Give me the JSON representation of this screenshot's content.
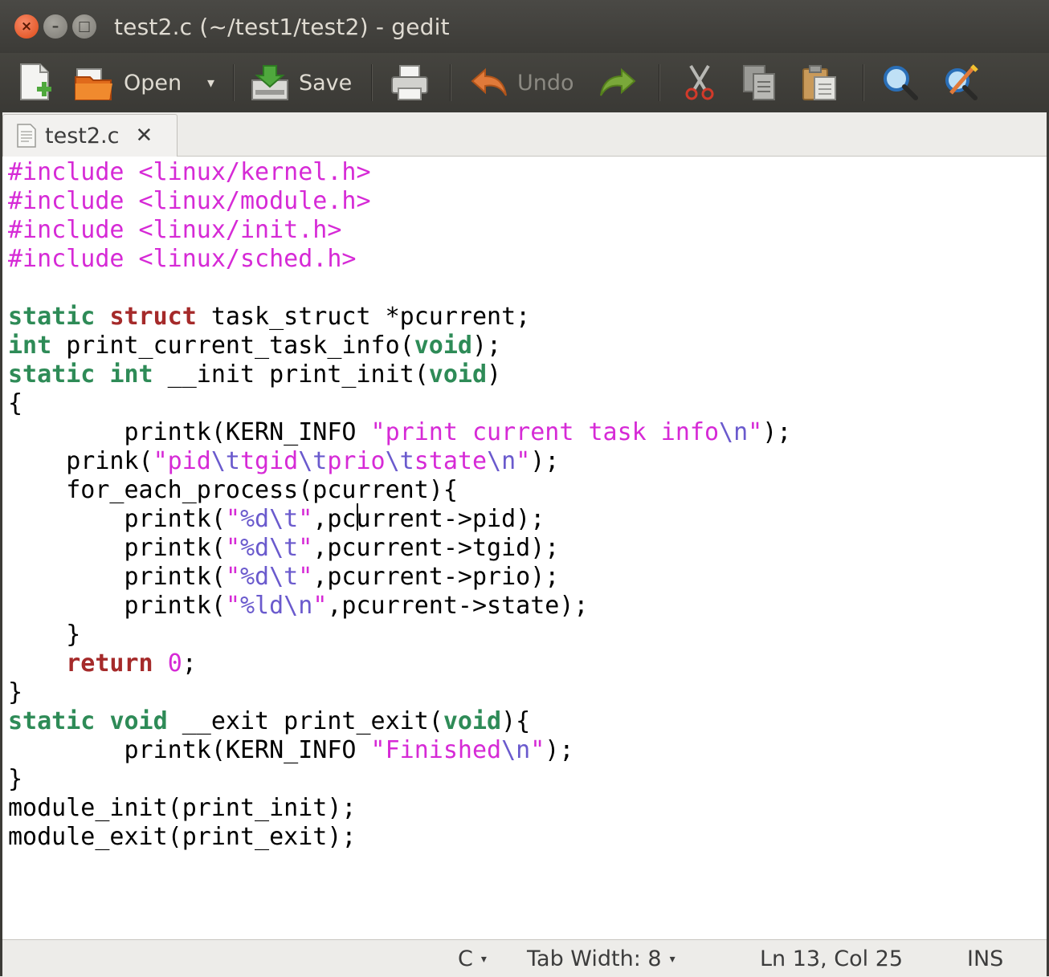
{
  "window": {
    "title": "test2.c (~/test1/test2) - gedit",
    "close_glyph": "×",
    "min_glyph": "–",
    "max_glyph": "□"
  },
  "toolbar": {
    "open_label": "Open",
    "save_label": "Save",
    "undo_label": "Undo",
    "dropdown_glyph": "▾"
  },
  "tab": {
    "name": "test2.c",
    "close_glyph": "✕"
  },
  "colors": {
    "preprocessor": "#d62ad6",
    "string": "#d62ad6",
    "escape": "#6a5acd",
    "keyword": "#2e8b57",
    "struct_kw": "#a52a2a",
    "number": "#d62ad6",
    "plain": "#000000"
  },
  "code_lines": [
    [
      {
        "t": "#include <linux/kernel.h>",
        "c": "preprocessor"
      }
    ],
    [
      {
        "t": "#include <linux/module.h>",
        "c": "preprocessor"
      }
    ],
    [
      {
        "t": "#include <linux/init.h>",
        "c": "preprocessor"
      }
    ],
    [
      {
        "t": "#include <linux/sched.h>",
        "c": "preprocessor"
      }
    ],
    [],
    [
      {
        "t": "static",
        "c": "keyword"
      },
      {
        "t": " ",
        "c": "plain"
      },
      {
        "t": "struct",
        "c": "struct_kw"
      },
      {
        "t": " task_struct *pcurrent;",
        "c": "plain"
      }
    ],
    [
      {
        "t": "int",
        "c": "keyword"
      },
      {
        "t": " print_current_task_info(",
        "c": "plain"
      },
      {
        "t": "void",
        "c": "keyword"
      },
      {
        "t": ");",
        "c": "plain"
      }
    ],
    [
      {
        "t": "static",
        "c": "keyword"
      },
      {
        "t": " ",
        "c": "plain"
      },
      {
        "t": "int",
        "c": "keyword"
      },
      {
        "t": " __init print_init(",
        "c": "plain"
      },
      {
        "t": "void",
        "c": "keyword"
      },
      {
        "t": ")",
        "c": "plain"
      }
    ],
    [
      {
        "t": "{",
        "c": "plain"
      }
    ],
    [
      {
        "t": "        printk(KERN_INFO ",
        "c": "plain"
      },
      {
        "t": "\"print current task info",
        "c": "string"
      },
      {
        "t": "\\n",
        "c": "escape"
      },
      {
        "t": "\"",
        "c": "string"
      },
      {
        "t": ");",
        "c": "plain"
      }
    ],
    [
      {
        "t": "    prink(",
        "c": "plain"
      },
      {
        "t": "\"pid",
        "c": "string"
      },
      {
        "t": "\\t",
        "c": "escape"
      },
      {
        "t": "tgid",
        "c": "string"
      },
      {
        "t": "\\t",
        "c": "escape"
      },
      {
        "t": "prio",
        "c": "string"
      },
      {
        "t": "\\t",
        "c": "escape"
      },
      {
        "t": "state",
        "c": "string"
      },
      {
        "t": "\\n",
        "c": "escape"
      },
      {
        "t": "\"",
        "c": "string"
      },
      {
        "t": ");",
        "c": "plain"
      }
    ],
    [
      {
        "t": "    for_each_process(pcurrent){",
        "c": "plain"
      }
    ],
    [
      {
        "t": "        printk(",
        "c": "plain"
      },
      {
        "t": "\"",
        "c": "string"
      },
      {
        "t": "%d\\t",
        "c": "escape"
      },
      {
        "t": "\"",
        "c": "string"
      },
      {
        "t": ",pcurrent->pid);",
        "c": "plain"
      }
    ],
    [
      {
        "t": "        printk(",
        "c": "plain"
      },
      {
        "t": "\"",
        "c": "string"
      },
      {
        "t": "%d\\t",
        "c": "escape"
      },
      {
        "t": "\"",
        "c": "string"
      },
      {
        "t": ",pcurrent->tgid);",
        "c": "plain"
      }
    ],
    [
      {
        "t": "        printk(",
        "c": "plain"
      },
      {
        "t": "\"",
        "c": "string"
      },
      {
        "t": "%d\\t",
        "c": "escape"
      },
      {
        "t": "\"",
        "c": "string"
      },
      {
        "t": ",pcurrent->prio);",
        "c": "plain"
      }
    ],
    [
      {
        "t": "        printk(",
        "c": "plain"
      },
      {
        "t": "\"",
        "c": "string"
      },
      {
        "t": "%ld\\n",
        "c": "escape"
      },
      {
        "t": "\"",
        "c": "string"
      },
      {
        "t": ",pcurrent->state);",
        "c": "plain"
      }
    ],
    [
      {
        "t": "    }",
        "c": "plain"
      }
    ],
    [
      {
        "t": "    ",
        "c": "plain"
      },
      {
        "t": "return",
        "c": "struct_kw"
      },
      {
        "t": " ",
        "c": "plain"
      },
      {
        "t": "0",
        "c": "number"
      },
      {
        "t": ";",
        "c": "plain"
      }
    ],
    [
      {
        "t": "}",
        "c": "plain"
      }
    ],
    [
      {
        "t": "static",
        "c": "keyword"
      },
      {
        "t": " ",
        "c": "plain"
      },
      {
        "t": "void",
        "c": "keyword"
      },
      {
        "t": " __exit print_exit(",
        "c": "plain"
      },
      {
        "t": "void",
        "c": "keyword"
      },
      {
        "t": "){",
        "c": "plain"
      }
    ],
    [
      {
        "t": "        printk(KERN_INFO ",
        "c": "plain"
      },
      {
        "t": "\"Finished",
        "c": "string"
      },
      {
        "t": "\\n",
        "c": "escape"
      },
      {
        "t": "\"",
        "c": "string"
      },
      {
        "t": ");",
        "c": "plain"
      }
    ],
    [
      {
        "t": "}",
        "c": "plain"
      }
    ],
    [
      {
        "t": "module_init(print_init);",
        "c": "plain"
      }
    ],
    [
      {
        "t": "module_exit(print_exit);",
        "c": "plain"
      }
    ]
  ],
  "status": {
    "language": "C",
    "tab_width": "Tab Width: 8",
    "position": "Ln 13, Col 25",
    "mode": "INS",
    "dropdown_glyph": "▾"
  }
}
